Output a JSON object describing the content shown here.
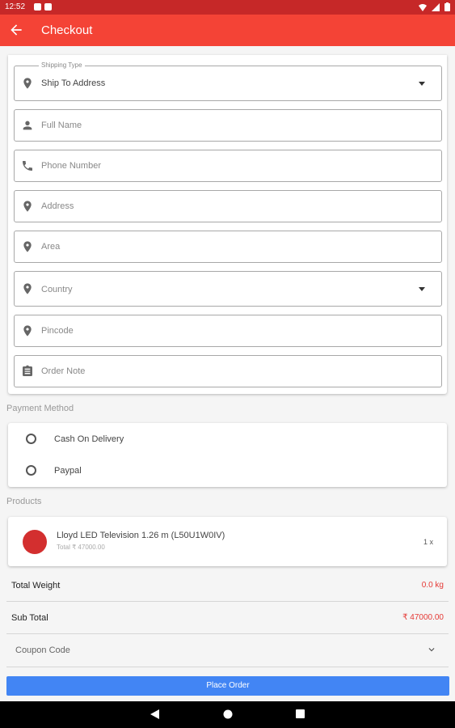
{
  "status_bar": {
    "time": "12:52"
  },
  "app_bar": {
    "title": "Checkout",
    "back_icon": "arrow-back-icon"
  },
  "shipping_form": {
    "shipping_type": {
      "label": "Shipping Type",
      "value": "Ship To Address",
      "icon": "location-pin-icon"
    },
    "full_name": {
      "placeholder": "Full Name",
      "icon": "person-icon"
    },
    "phone_number": {
      "placeholder": "Phone Number",
      "icon": "phone-icon"
    },
    "address": {
      "placeholder": "Address",
      "icon": "location-pin-icon"
    },
    "area": {
      "placeholder": "Area",
      "icon": "location-pin-icon"
    },
    "country": {
      "placeholder": "Country",
      "icon": "location-pin-icon"
    },
    "pincode": {
      "placeholder": "Pincode",
      "icon": "location-pin-icon"
    },
    "order_note": {
      "placeholder": "Order Note",
      "icon": "clipboard-icon"
    }
  },
  "payment": {
    "section_label": "Payment Method",
    "options": [
      {
        "label": "Cash On Delivery",
        "selected": false
      },
      {
        "label": "Paypal",
        "selected": false
      }
    ]
  },
  "products": {
    "section_label": "Products",
    "items": [
      {
        "name": "Lloyd LED Television 1.26 m (L50U1W0IV)",
        "total": "Total ₹ 47000.00",
        "qty": "1 x"
      }
    ]
  },
  "summary": {
    "total_weight": {
      "label": "Total Weight",
      "value": "0.0 kg"
    },
    "sub_total": {
      "label": "Sub Total",
      "value": "₹ 47000.00"
    }
  },
  "coupon": {
    "label": "Coupon Code"
  },
  "actions": {
    "place_order": "Place Order"
  },
  "colors": {
    "status_bar": "#c62828",
    "app_bar": "#f44336",
    "primary_button": "#4285f4",
    "price": "#e53935"
  }
}
